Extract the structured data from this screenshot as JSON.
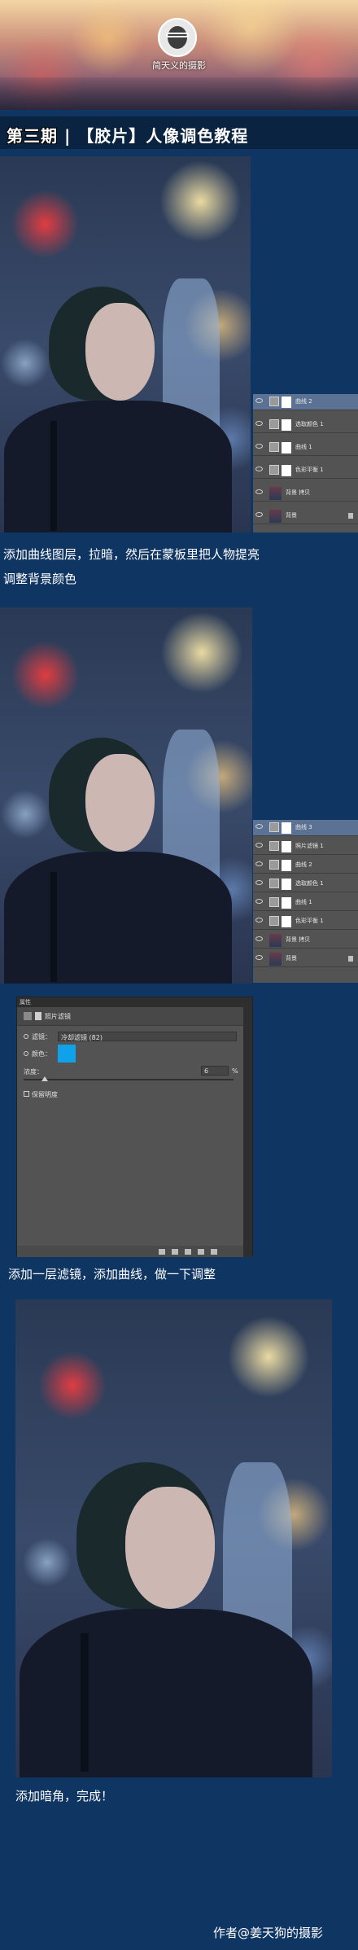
{
  "header": {
    "author_small": "简天义的摄影"
  },
  "title": {
    "episode": "第三期",
    "separator": "|",
    "topic": "【胶片】人像调色教程"
  },
  "layers_panel_1": {
    "layers": [
      {
        "label": "曲线 2",
        "selected": true,
        "type": "adjustment"
      },
      {
        "label": "选取颜色 1",
        "selected": false,
        "type": "adjustment"
      },
      {
        "label": "曲线 1",
        "selected": false,
        "type": "adjustment"
      },
      {
        "label": "色彩平衡 1",
        "selected": false,
        "type": "adjustment"
      },
      {
        "label": "背景 拷贝",
        "selected": false,
        "type": "image"
      },
      {
        "label": "背景",
        "selected": false,
        "type": "image",
        "locked": true
      }
    ]
  },
  "caption_1": {
    "line1": "添加曲线图层，拉暗，然后在蒙板里把人物提亮",
    "line2": "调整背景颜色"
  },
  "layers_panel_2": {
    "layers": [
      {
        "label": "曲线 3",
        "selected": true,
        "type": "adjustment"
      },
      {
        "label": "照片滤镜 1",
        "selected": false,
        "type": "adjustment"
      },
      {
        "label": "曲线 2",
        "selected": false,
        "type": "adjustment"
      },
      {
        "label": "选取颜色 1",
        "selected": false,
        "type": "adjustment"
      },
      {
        "label": "曲线 1",
        "selected": false,
        "type": "adjustment"
      },
      {
        "label": "色彩平衡 1",
        "selected": false,
        "type": "adjustment"
      },
      {
        "label": "背景 拷贝",
        "selected": false,
        "type": "image"
      },
      {
        "label": "背景",
        "selected": false,
        "type": "image",
        "locked": true
      }
    ]
  },
  "properties_panel": {
    "tab": "属性",
    "header": "照片滤镜",
    "filter_label": "滤镜：",
    "filter_value": "冷却滤镜 (82)",
    "color_label": "颜色：",
    "density_label": "浓度：",
    "density_value": "6",
    "density_unit": "%",
    "preserve_luminosity": "保留明度",
    "color": "#0fa2ea"
  },
  "caption_2": "添加一层滤镜，添加曲线，做一下调整",
  "caption_3": "添加暗角，完成！",
  "footer": "作者@姜天狗的摄影"
}
